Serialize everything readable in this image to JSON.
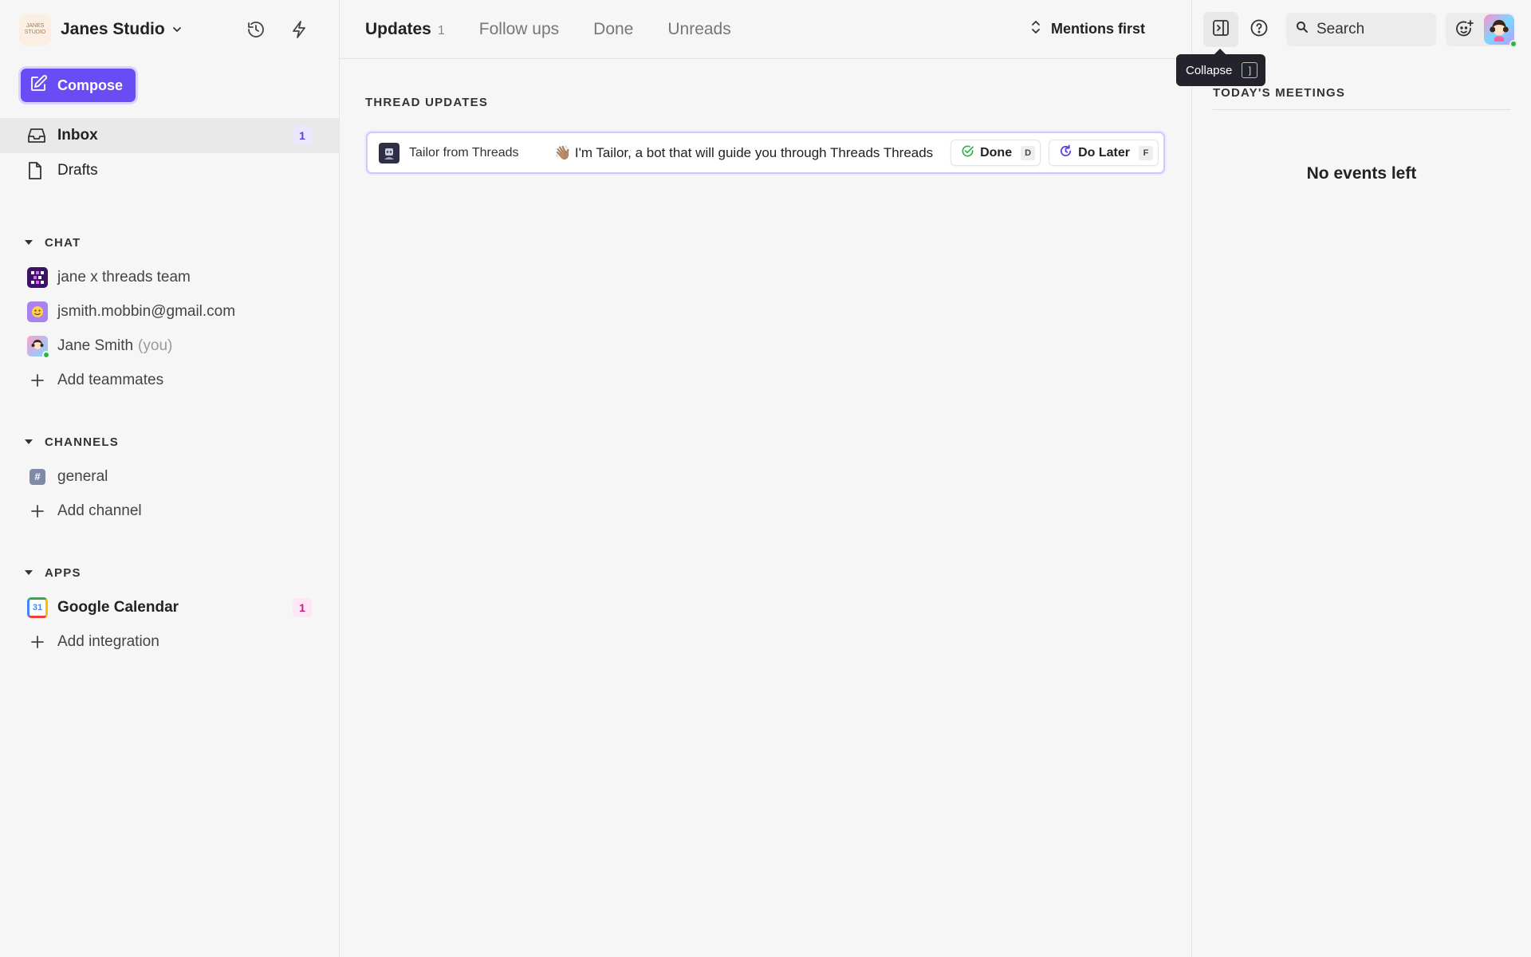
{
  "workspace": {
    "name": "Janes Studio",
    "logo_text": "JANES STUDIO"
  },
  "compose": {
    "label": "Compose"
  },
  "nav": [
    {
      "label": "Inbox",
      "badge": "1"
    },
    {
      "label": "Drafts"
    }
  ],
  "chat": {
    "title": "CHAT",
    "items": [
      {
        "label": "jane x threads team"
      },
      {
        "label": "jsmith.mobbin@gmail.com"
      },
      {
        "label": "Jane Smith",
        "suffix": "(you)"
      }
    ],
    "add_label": "Add teammates"
  },
  "channels": {
    "title": "CHANNELS",
    "items": [
      {
        "label": "general",
        "icon_text": "#"
      }
    ],
    "add_label": "Add channel"
  },
  "apps": {
    "title": "APPS",
    "items": [
      {
        "label": "Google Calendar",
        "badge": "1",
        "icon_text": "31"
      }
    ],
    "add_label": "Add integration"
  },
  "tabs": [
    {
      "label": "Updates",
      "count": "1"
    },
    {
      "label": "Follow ups"
    },
    {
      "label": "Done"
    },
    {
      "label": "Unreads"
    }
  ],
  "sort": {
    "label": "Mentions first"
  },
  "thread_updates": {
    "title": "THREAD UPDATES",
    "rows": [
      {
        "sender": "Tailor from Threads",
        "snippet": "👋🏽 I'm Tailor, a bot that will guide you through Threads Threads",
        "done_label": "Done",
        "done_key": "D",
        "later_label": "Do Later",
        "later_key": "F"
      }
    ]
  },
  "right_panel": {
    "search_placeholder": "Search",
    "meetings_title": "TODAY'S MEETINGS",
    "empty_text": "No events left"
  },
  "tooltip": {
    "label": "Collapse",
    "key": "]"
  },
  "colors": {
    "accent": "#6a4cf5",
    "online": "#2fb34a",
    "badge_pink": "#c21f86"
  }
}
